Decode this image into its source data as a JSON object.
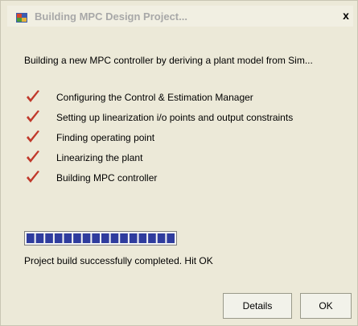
{
  "window": {
    "title": "Building MPC Design Project...",
    "close_glyph": "x"
  },
  "intro_text": "Building a new MPC controller by deriving a plant model from Sim...",
  "steps": [
    {
      "label": "Configuring the Control & Estimation Manager",
      "icon": "check-icon",
      "done": true
    },
    {
      "label": "Setting up linearization i/o points and output constraints",
      "icon": "check-icon",
      "done": true
    },
    {
      "label": "Finding operating point",
      "icon": "check-icon",
      "done": true
    },
    {
      "label": "Linearizing the plant",
      "icon": "check-icon",
      "done": true
    },
    {
      "label": "Building MPC controller",
      "icon": "check-icon",
      "done": true
    }
  ],
  "progress": {
    "fraction": 1.0,
    "segments": 16,
    "color": "#2f3c9e"
  },
  "status_text": "Project build successfully completed. Hit OK",
  "buttons": {
    "details": "Details",
    "ok": "OK"
  },
  "colors": {
    "check": "#c0392b",
    "title_text": "#a8a8a8"
  }
}
